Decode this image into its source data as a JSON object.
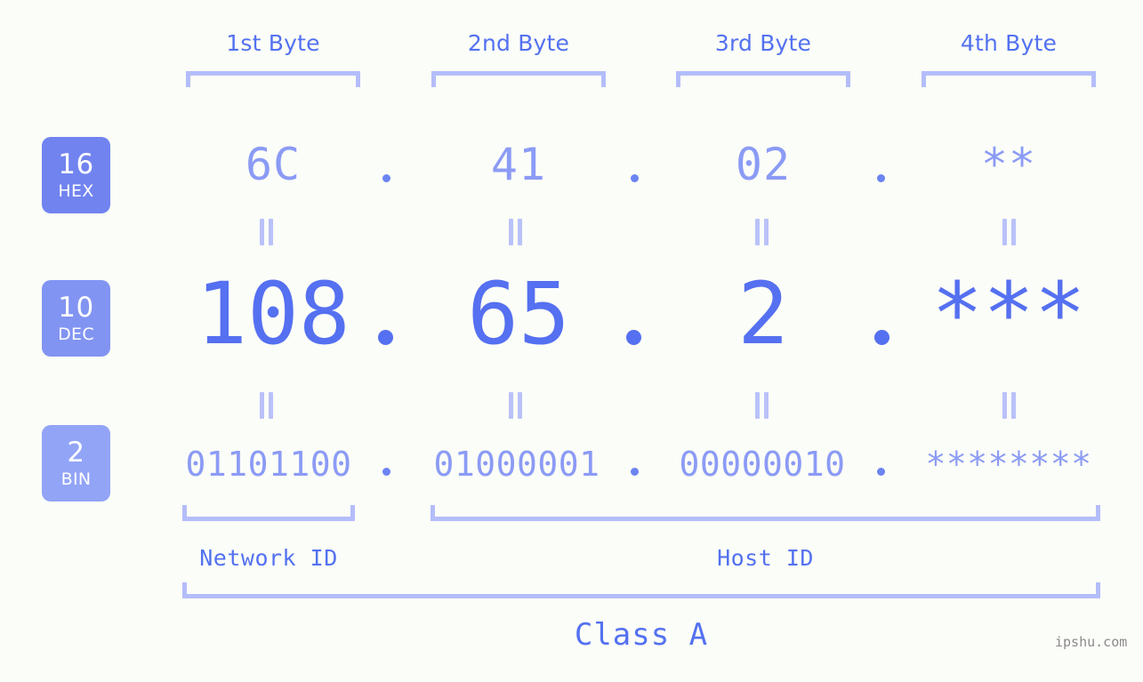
{
  "page": {
    "background_color": "#fbfdf8",
    "accent_color": "#5371f0",
    "muted_accent_color": "#8b9bf5",
    "bracket_color": "#b3bdfa",
    "watermark": "ipshu.com"
  },
  "byte_headers": [
    {
      "label": "1st Byte"
    },
    {
      "label": "2nd Byte"
    },
    {
      "label": "3rd Byte"
    },
    {
      "label": "4th Byte"
    }
  ],
  "rows": [
    {
      "base_number": "16",
      "base_abbr": "HEX",
      "badge_color": "#7183ef",
      "values": [
        "6C",
        "41",
        "02",
        "**"
      ],
      "separator": "."
    },
    {
      "base_number": "10",
      "base_abbr": "DEC",
      "badge_color": "#8294f2",
      "values": [
        "108",
        "65",
        "2",
        "***"
      ],
      "separator": "."
    },
    {
      "base_number": "2",
      "base_abbr": "BIN",
      "badge_color": "#92a4f6",
      "values": [
        "01101100",
        "01000001",
        "00000010",
        "********"
      ],
      "separator": "."
    }
  ],
  "segments": [
    {
      "label": "Network ID"
    },
    {
      "label": "Host ID"
    }
  ],
  "class": {
    "label": "Class A"
  }
}
